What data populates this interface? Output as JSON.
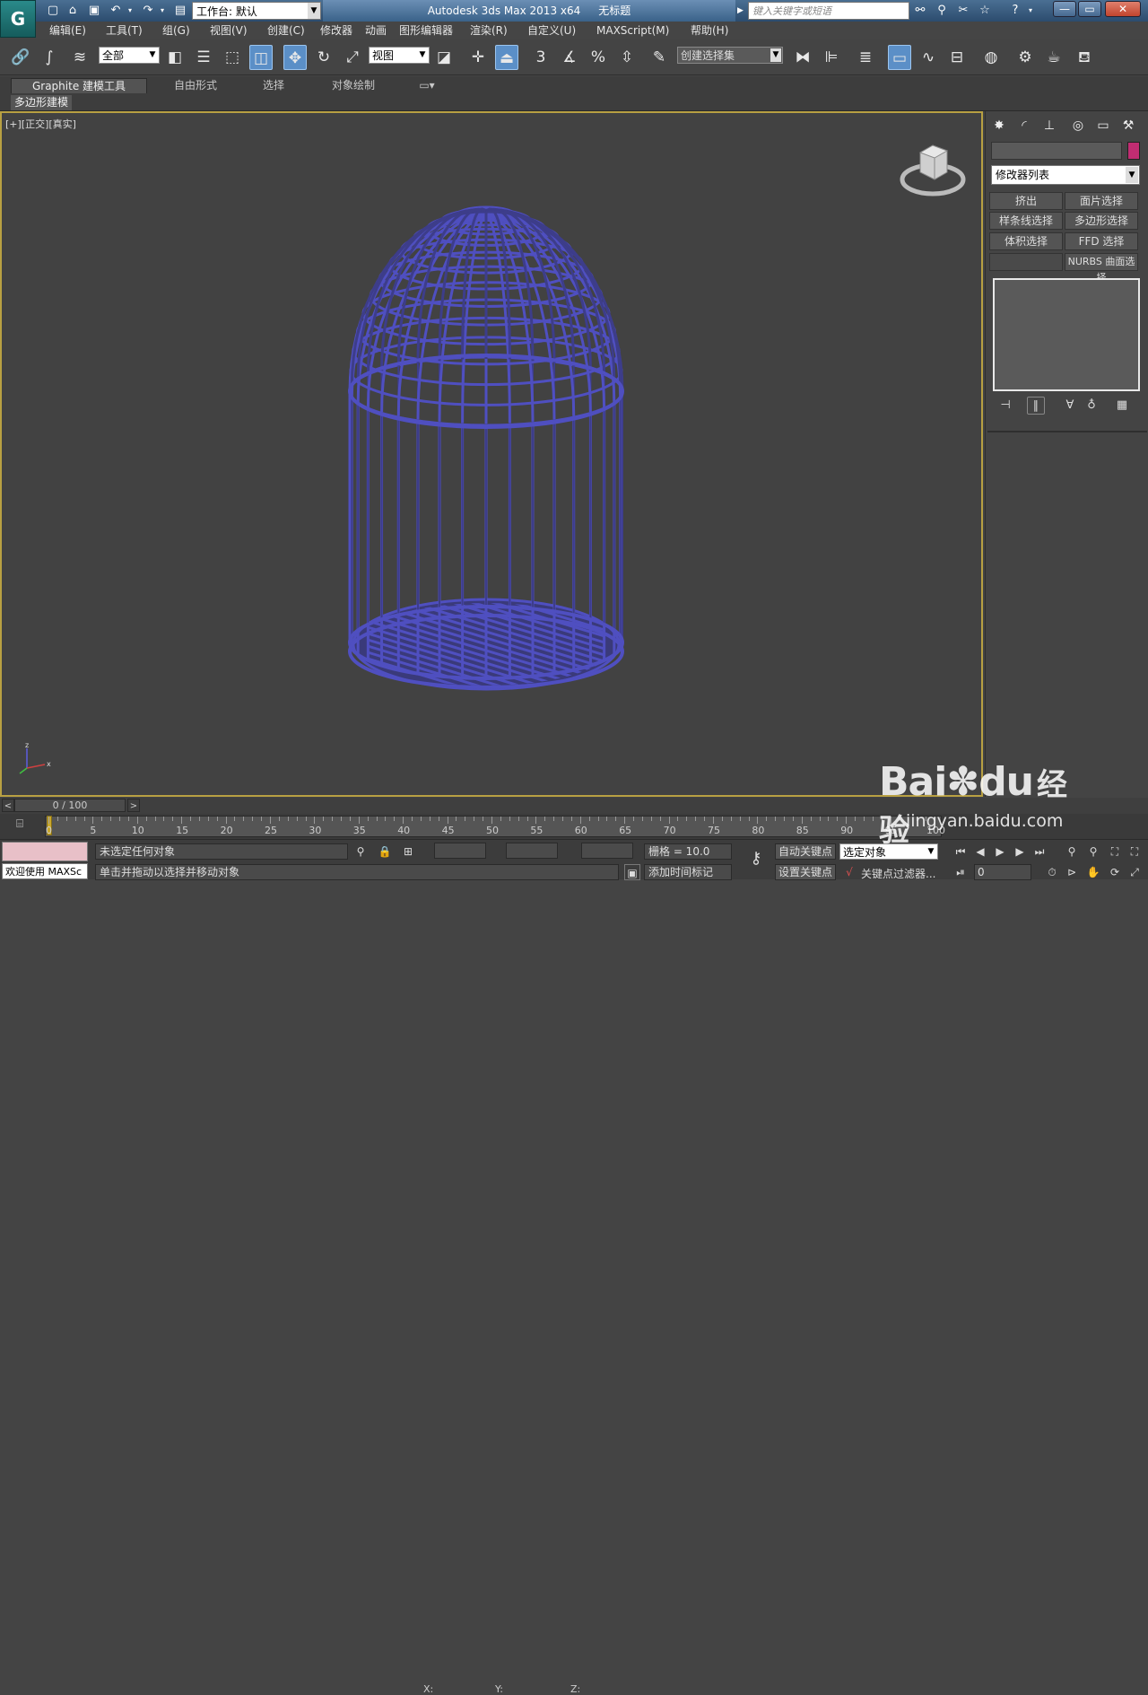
{
  "titlebar": {
    "workspace_label": "工作台: 默认",
    "app_name": "Autodesk 3ds Max  2013 x64",
    "document_title": "无标题",
    "search_placeholder": "键入关键字或短语",
    "min": "—",
    "restore": "▭",
    "close": "✕"
  },
  "menu": [
    "编辑(E)",
    "工具(T)",
    "组(G)",
    "视图(V)",
    "创建(C)",
    "修改器",
    "动画",
    "图形编辑器",
    "渲染(R)",
    "自定义(U)",
    "MAXScript(M)",
    "帮助(H)"
  ],
  "toolbar": {
    "selection_filter": "全部",
    "ref_coord": "视图",
    "named_selection": "创建选择集",
    "snap_3": "3",
    "percent": "%"
  },
  "ribbon": {
    "tabs": [
      "Graphite 建模工具",
      "自由形式",
      "选择",
      "对象绘制"
    ],
    "subtab": "多边形建模"
  },
  "viewport": {
    "label": "[+][正交][真实]",
    "object_color": "#4f4fc0",
    "axis_z": "z",
    "axis_x": "x"
  },
  "command_panel": {
    "modifier_list": "修改器列表",
    "buttons": [
      "挤出",
      "面片选择",
      "样条线选择",
      "多边形选择",
      "体积选择",
      "FFD 选择",
      "",
      "NURBS 曲面选择"
    ],
    "swatch_color": "#c02d72"
  },
  "timeline": {
    "frame_display": "0 / 100",
    "prev": "<",
    "next": ">",
    "ticks": [
      "0",
      "5",
      "10",
      "15",
      "20",
      "25",
      "30",
      "35",
      "40",
      "45",
      "50",
      "55",
      "60",
      "65",
      "70",
      "75",
      "80",
      "85",
      "90",
      "95",
      "100"
    ]
  },
  "status": {
    "welcome": "欢迎使用 MAXSc",
    "selection_status": "未选定任何对象",
    "prompt": "单击并拖动以选择并移动对象",
    "x_label": "X:",
    "y_label": "Y:",
    "z_label": "Z:",
    "grid": "栅格 = 10.0",
    "add_time_tag": "添加时间标记",
    "auto_key": "自动关键点",
    "set_key": "设置关键点",
    "key_mode": "选定对象",
    "key_filters": "关键点过滤器...",
    "current_frame": "0"
  },
  "watermark": {
    "brand": "Bai",
    "brand2": "du",
    "service": "经验",
    "url": "jingyan.baidu.com"
  }
}
